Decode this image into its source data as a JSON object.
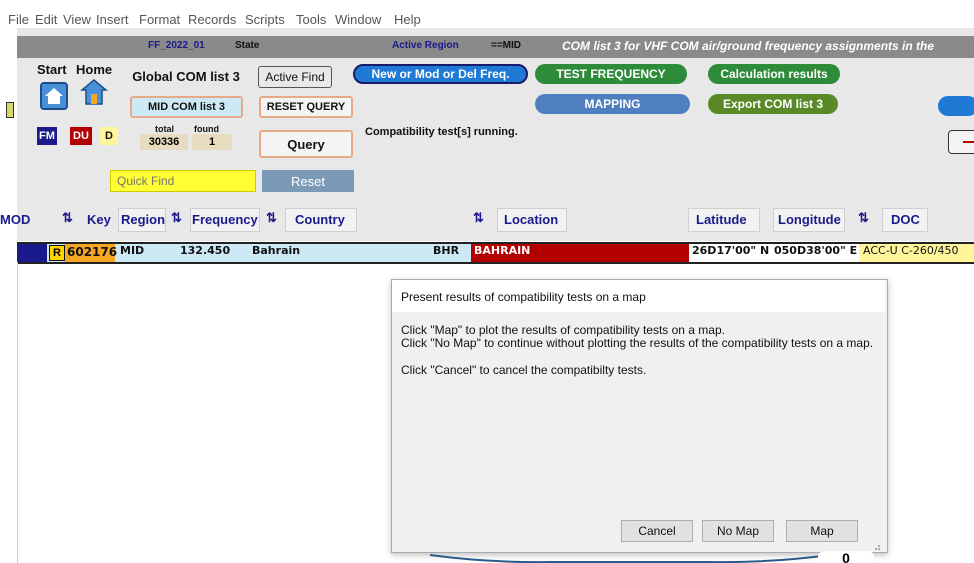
{
  "menu": [
    "File",
    "Edit",
    "View",
    "Insert",
    "Format",
    "Records",
    "Scripts",
    "Tools",
    "Window",
    "Help"
  ],
  "header": {
    "file": "FF_2022_01",
    "state": "State",
    "active_region_label": "Active Region",
    "active_region_value": "==MID",
    "title": "COM list 3 for VHF COM air/ground frequency assignments in the"
  },
  "nav": {
    "start": "Start",
    "home": "Home"
  },
  "buttons": {
    "global_com": "Global COM list 3",
    "mid_com": "MID COM list 3",
    "active_find": "Active Find",
    "reset_query": "RESET QUERY",
    "query": "Query",
    "new_mod_del": "New or Mod or Del Freq.",
    "test_frequency": "TEST FREQUENCY",
    "calculation_results": "Calculation results",
    "mapping": "MAPPING",
    "export": "Export COM list 3",
    "reset": "Reset"
  },
  "tags": {
    "fm": "FM",
    "du": "DU",
    "d": "D"
  },
  "counts": {
    "total_label": "total",
    "found_label": "found",
    "total": "30336",
    "found": "1"
  },
  "status": "Compatibility test[s] running.",
  "quick_find": {
    "placeholder": "Quick Find"
  },
  "columns": [
    "MOD",
    "Key",
    "Region",
    "Frequency",
    "Country",
    "Location",
    "Latitude",
    "Longitude",
    "DOC"
  ],
  "row": {
    "mod": "R",
    "key": "602176",
    "region": "MID",
    "frequency": "132.450",
    "country": "Bahrain",
    "code": "BHR",
    "location": "BAHRAIN",
    "latitude": "26D17'00\" N",
    "longitude": "050D38'00\" E",
    "doc": "ACC-U C-260/450"
  },
  "modal": {
    "title": "Present results of compatibility tests on a map",
    "lines": [
      "Click \"Map\" to plot the results of compatibility tests on a map.",
      "Click \"No Map\" to continue without plotting the results of the compatibility tests on a map.",
      "Click \"Cancel\" to cancel the compatibilty tests."
    ],
    "cancel": "Cancel",
    "no_map": "No Map",
    "map": "Map"
  },
  "bottom_digit": "0",
  "colors": {
    "panel": "#e8e8e8",
    "header": "#8a8a8a",
    "row": "#cde9f5",
    "location": "#b30000",
    "key": "#f5a623"
  }
}
